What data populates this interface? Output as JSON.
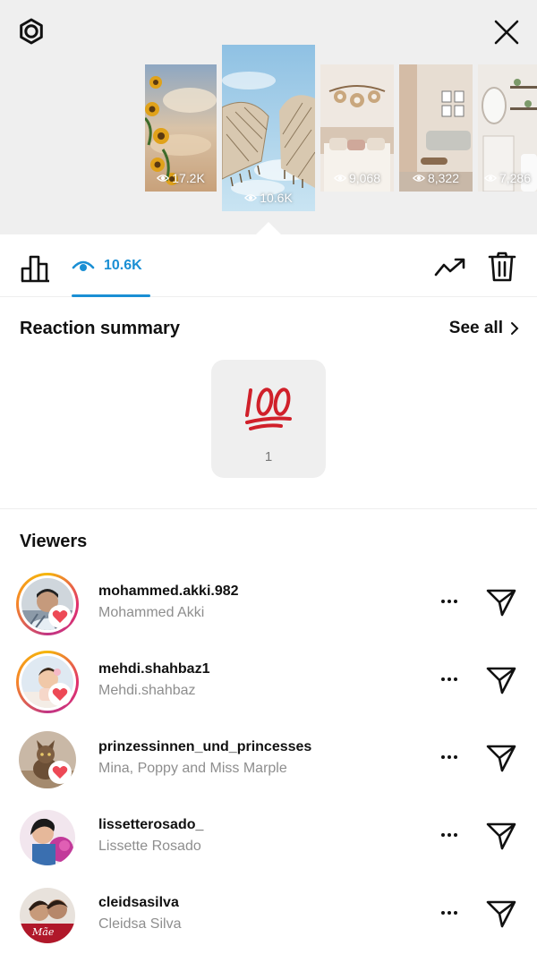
{
  "header": {
    "settings_icon": "gear-icon",
    "close_icon": "close-icon"
  },
  "stories": [
    {
      "views": "17.2K",
      "theme": "sunflowers-sky"
    },
    {
      "views": "10.6K",
      "theme": "macrame-sky",
      "selected": true
    },
    {
      "views": "9,068",
      "theme": "bedroom-decor"
    },
    {
      "views": "8,322",
      "theme": "living-room"
    },
    {
      "views": "7,286",
      "theme": "bathroom"
    }
  ],
  "toolbar": {
    "views_label": "10.6K",
    "icons": [
      "bar-chart-icon",
      "eye-icon",
      "trend-icon",
      "trash-icon"
    ]
  },
  "reactions": {
    "title": "Reaction summary",
    "see_all_label": "See all",
    "items": [
      {
        "emoji": "💯",
        "count": "1"
      }
    ]
  },
  "viewers": {
    "title": "Viewers",
    "list": [
      {
        "username": "mohammed.akki.982",
        "name": "Mohammed Akki",
        "liked": true,
        "story_ring": true
      },
      {
        "username": "mehdi.shahbaz1",
        "name": "Mehdi.shahbaz",
        "liked": true,
        "story_ring": true
      },
      {
        "username": "prinzessinnen_und_princesses",
        "name": "Mina, Poppy and Miss Marple",
        "liked": true,
        "story_ring": false
      },
      {
        "username": "lissetterosado_",
        "name": "Lissette Rosado",
        "liked": false,
        "story_ring": false
      },
      {
        "username": "cleidsasilva",
        "name": "Cleidsa Silva",
        "liked": false,
        "story_ring": false
      }
    ]
  },
  "avatar_badge_text": "Mãe",
  "colors": {
    "accent": "#1a8fd4",
    "heart": "#ed4956",
    "secondary_text": "#8e8e8e"
  }
}
